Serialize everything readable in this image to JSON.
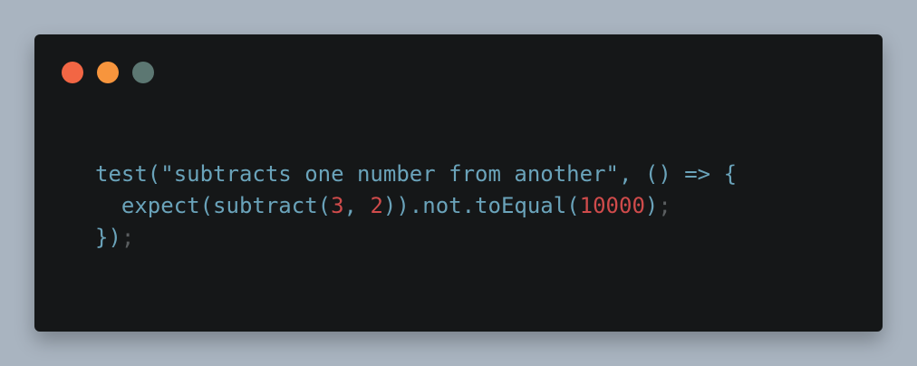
{
  "window": {
    "traffic_lights": {
      "red": "#f26644",
      "orange": "#f7953d",
      "gray": "#5c7772"
    }
  },
  "code": {
    "lines": [
      {
        "tokens": [
          {
            "text": "test(\"subtracts one number from another\", () => {",
            "type": "ident"
          }
        ]
      },
      {
        "tokens": [
          {
            "text": "  expect(subtract(",
            "type": "ident"
          },
          {
            "text": "3",
            "type": "num"
          },
          {
            "text": ", ",
            "type": "ident"
          },
          {
            "text": "2",
            "type": "num"
          },
          {
            "text": ")).not.toEqual(",
            "type": "ident"
          },
          {
            "text": "10000",
            "type": "num"
          },
          {
            "text": ")",
            "type": "ident"
          },
          {
            "text": ";",
            "type": "dim"
          }
        ]
      },
      {
        "tokens": [
          {
            "text": "})",
            "type": "ident"
          },
          {
            "text": ";",
            "type": "dim"
          }
        ]
      }
    ]
  }
}
